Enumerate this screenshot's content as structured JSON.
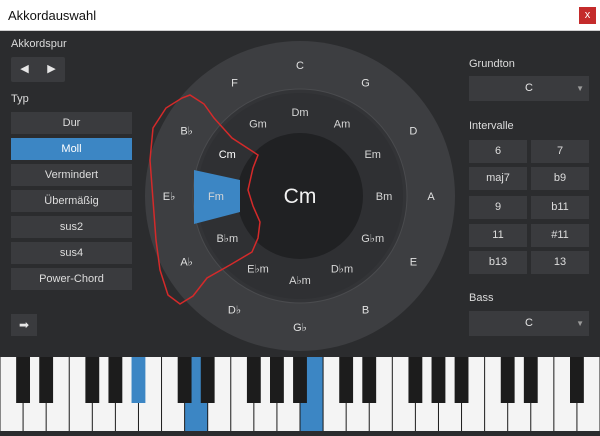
{
  "window": {
    "title": "Akkordauswahl",
    "close_label": "x"
  },
  "left": {
    "chord_track_label": "Akkordspur",
    "nav_prev": "◀",
    "nav_next": "▶",
    "type_label": "Typ",
    "types": [
      "Dur",
      "Moll",
      "Vermindert",
      "Übermäßig",
      "sus2",
      "sus4",
      "Power-Chord"
    ],
    "selected_type": "Moll",
    "insert_icon_glyph": "➡"
  },
  "circle": {
    "center_chord": "Cm",
    "outer": [
      "C",
      "G",
      "D",
      "A",
      "E",
      "B",
      "G♭",
      "D♭",
      "A♭",
      "E♭",
      "B♭",
      "F"
    ],
    "inner": [
      "Am",
      "Em",
      "Bm",
      "G♭m",
      "D♭m",
      "A♭m",
      "E♭m",
      "B♭m",
      "Fm",
      "Cm",
      "Gm",
      "Dm"
    ],
    "selected_inner": "Cm",
    "colors": {
      "accent": "#3c86c4",
      "annotation": "#d42a2a"
    }
  },
  "right": {
    "root_label": "Grundton",
    "root_value": "C",
    "intervals_label": "Intervalle",
    "intervals": [
      "6",
      "7",
      "maj7",
      "b9",
      "9",
      "b11",
      "11",
      "#11",
      "b13",
      "13"
    ],
    "bass_label": "Bass",
    "bass_value": "C"
  },
  "keyboard": {
    "highlighted_white_keys": [
      8,
      13
    ],
    "highlighted_black_keys": [
      4
    ]
  }
}
